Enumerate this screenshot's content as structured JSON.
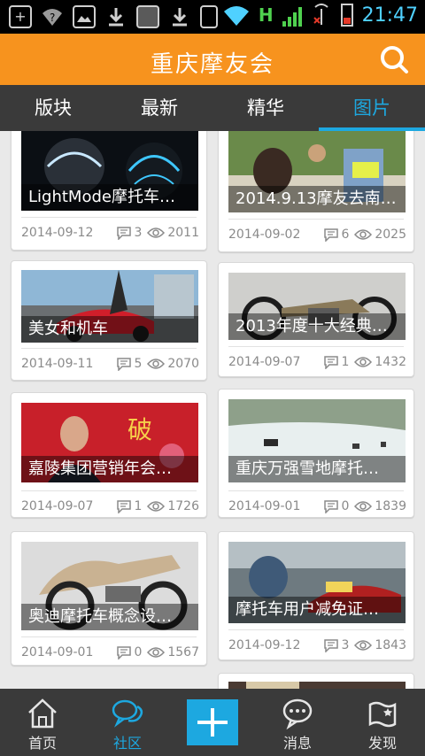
{
  "status_bar": {
    "time": "21:47"
  },
  "header": {
    "title": "重庆摩友会"
  },
  "tabs": [
    {
      "label": "版块"
    },
    {
      "label": "最新"
    },
    {
      "label": "精华"
    },
    {
      "label": "图片",
      "active": true
    }
  ],
  "posts": [
    {
      "caption": "LightMode摩托车…",
      "date": "2014-09-12",
      "comments": "3",
      "views": "2011"
    },
    {
      "caption": "2014.9.13摩友去南…",
      "date": "2014-09-02",
      "comments": "6",
      "views": "2025"
    },
    {
      "caption": "美女和机车",
      "date": "2014-09-11",
      "comments": "5",
      "views": "2070"
    },
    {
      "caption": "2013年度十大经典…",
      "date": "2014-09-07",
      "comments": "1",
      "views": "1432"
    },
    {
      "caption": "嘉陵集团营销年会…",
      "date": "2014-09-07",
      "comments": "1",
      "views": "1726"
    },
    {
      "caption": "重庆万强雪地摩托…",
      "date": "2014-09-01",
      "comments": "0",
      "views": "1839"
    },
    {
      "caption": "奥迪摩托车概念设…",
      "date": "2014-09-01",
      "comments": "0",
      "views": "1567"
    },
    {
      "caption": "摩托车用户减免证…",
      "date": "2014-09-12",
      "comments": "3",
      "views": "1843"
    }
  ],
  "bottom_nav": [
    {
      "label": "首页",
      "icon": "home-icon"
    },
    {
      "label": "社区",
      "icon": "community-icon",
      "active": true
    },
    {
      "label": "",
      "icon": "plus-icon"
    },
    {
      "label": "消息",
      "icon": "message-icon"
    },
    {
      "label": "发现",
      "icon": "discover-icon"
    }
  ],
  "colors": {
    "accent": "#f7931e",
    "highlight": "#1da8e0",
    "bar": "#3a3a3a"
  }
}
